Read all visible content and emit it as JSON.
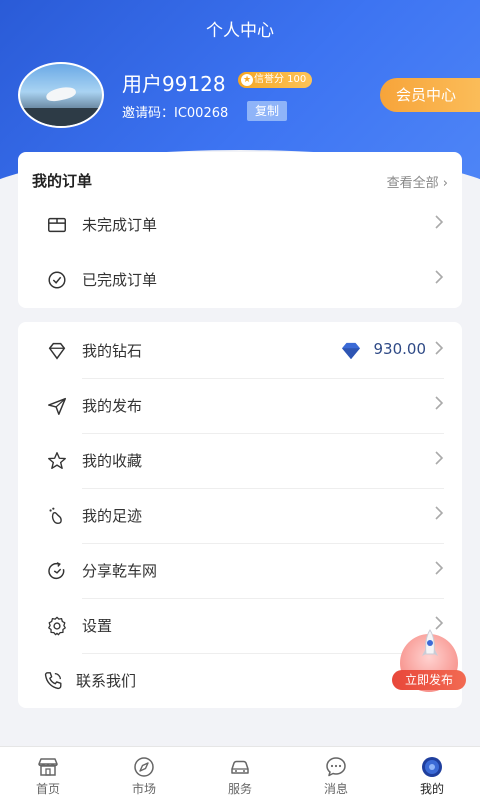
{
  "header": {
    "title": "个人中心",
    "username": "用户99128",
    "credit_badge": "信誉分 100",
    "invite_label": "邀请码：IC00268",
    "copy_label": "复制",
    "vip_label": "会员中心"
  },
  "orders": {
    "title": "我的订单",
    "view_all": "查看全部",
    "items": [
      {
        "label": "未完成订单",
        "icon": "order-box-icon"
      },
      {
        "label": "已完成订单",
        "icon": "check-circle-icon"
      }
    ]
  },
  "menu": {
    "items": [
      {
        "label": "我的钻石",
        "icon": "diamond-icon",
        "value": "930.00"
      },
      {
        "label": "我的发布",
        "icon": "send-icon"
      },
      {
        "label": "我的收藏",
        "icon": "star-icon"
      },
      {
        "label": "我的足迹",
        "icon": "footprint-icon"
      },
      {
        "label": "分享乾车网",
        "icon": "share-icon"
      },
      {
        "label": "设置",
        "icon": "gear-icon"
      },
      {
        "label": "联系我们",
        "icon": "phone-icon"
      }
    ]
  },
  "fab": {
    "label": "立即发布"
  },
  "tabbar": {
    "items": [
      {
        "label": "首页",
        "icon": "home-icon"
      },
      {
        "label": "市场",
        "icon": "compass-icon"
      },
      {
        "label": "服务",
        "icon": "car-icon"
      },
      {
        "label": "消息",
        "icon": "chat-icon"
      },
      {
        "label": "我的",
        "icon": "profile-icon",
        "active": true
      }
    ]
  },
  "colors": {
    "primary": "#3d74f2",
    "accent": "#f7a43a",
    "fab": "#e8473a",
    "diamond": "#3b6ad6"
  }
}
